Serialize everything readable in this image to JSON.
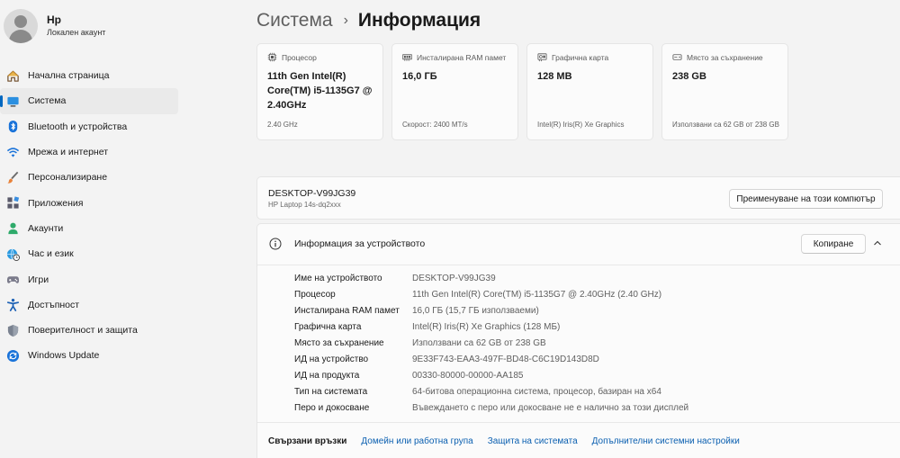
{
  "profile": {
    "name": "Hp",
    "account_type": "Локален акаунт"
  },
  "sidebar": {
    "items": [
      {
        "label": "Начална страница",
        "icon": "home-icon"
      },
      {
        "label": "Система",
        "icon": "system-icon",
        "active": true
      },
      {
        "label": "Bluetooth и устройства",
        "icon": "bluetooth-icon"
      },
      {
        "label": "Мрежа и интернет",
        "icon": "wifi-icon"
      },
      {
        "label": "Персонализиране",
        "icon": "brush-icon"
      },
      {
        "label": "Приложения",
        "icon": "apps-icon"
      },
      {
        "label": "Акаунти",
        "icon": "person-icon"
      },
      {
        "label": "Час и език",
        "icon": "globe-clock-icon"
      },
      {
        "label": "Игри",
        "icon": "gamepad-icon"
      },
      {
        "label": "Достъпност",
        "icon": "accessibility-icon"
      },
      {
        "label": "Поверителност и защита",
        "icon": "shield-icon"
      },
      {
        "label": "Windows Update",
        "icon": "update-icon"
      }
    ]
  },
  "header": {
    "parent": "Система",
    "separator": "›",
    "current": "Информация"
  },
  "cards": [
    {
      "title": "Процесор",
      "icon": "cpu-icon",
      "value": "11th Gen Intel(R) Core(TM) i5-1135G7 @ 2.40GHz",
      "sub": "2.40 GHz"
    },
    {
      "title": "Инсталирана RAM памет",
      "icon": "ram-icon",
      "value": "16,0 ГБ",
      "sub": "Скорост: 2400 MT/s"
    },
    {
      "title": "Графична карта",
      "icon": "gpu-icon",
      "value": "128 MB",
      "sub": "Intel(R) Iris(R) Xe Graphics"
    },
    {
      "title": "Място за съхранение",
      "icon": "storage-icon",
      "value": "238 GB",
      "sub": "Използвани са 62 GB от 238 GB"
    }
  ],
  "device": {
    "name": "DESKTOP-V99JG39",
    "model": "HP Laptop 14s-dq2xxx",
    "rename_label": "Преименуване на този компютър"
  },
  "device_info": {
    "title": "Информация за устройството",
    "copy_label": "Копиране",
    "rows": [
      {
        "label": "Име на устройството",
        "value": "DESKTOP-V99JG39"
      },
      {
        "label": "Процесор",
        "value": "11th Gen Intel(R) Core(TM) i5-1135G7 @ 2.40GHz (2.40 GHz)"
      },
      {
        "label": "Инсталирана RAM памет",
        "value": "16,0 ГБ (15,7 ГБ използваеми)"
      },
      {
        "label": "Графична карта",
        "value": "Intel(R) Iris(R) Xe Graphics (128 МБ)"
      },
      {
        "label": "Място за съхранение",
        "value": "Използвани са 62 GB от 238 GB"
      },
      {
        "label": "ИД на устройство",
        "value": "9E33F743-EAA3-497F-BD48-C6C19D143D8D"
      },
      {
        "label": "ИД на продукта",
        "value": "00330-80000-00000-AA185"
      },
      {
        "label": "Тип на системата",
        "value": "64-битова операционна система, процесор, базиран на x64"
      },
      {
        "label": "Перо и докосване",
        "value": "Въвеждането с перо или докосване не е налично за този дисплей"
      }
    ]
  },
  "related": {
    "label": "Свързани връзки",
    "links": [
      "Домейн или работна група",
      "Защита на системата",
      "Допълнителни системни настройки"
    ]
  },
  "colors": {
    "accent": "#0067c0",
    "link": "#0a5fb0",
    "background": "#f3f3f3",
    "card": "#fbfbfb"
  }
}
